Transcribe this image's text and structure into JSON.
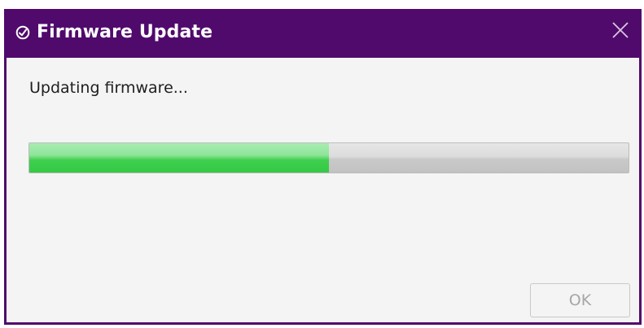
{
  "window": {
    "title": "Firmware Update",
    "title_icon": "circle-check-icon",
    "close_icon": "close-icon",
    "accent_color": "#500a6c"
  },
  "status": {
    "message": "Updating firmware..."
  },
  "progress": {
    "fraction": 0.5,
    "fill_color": "#3fcf4e"
  },
  "buttons": {
    "ok_label": "OK",
    "ok_enabled": false
  }
}
